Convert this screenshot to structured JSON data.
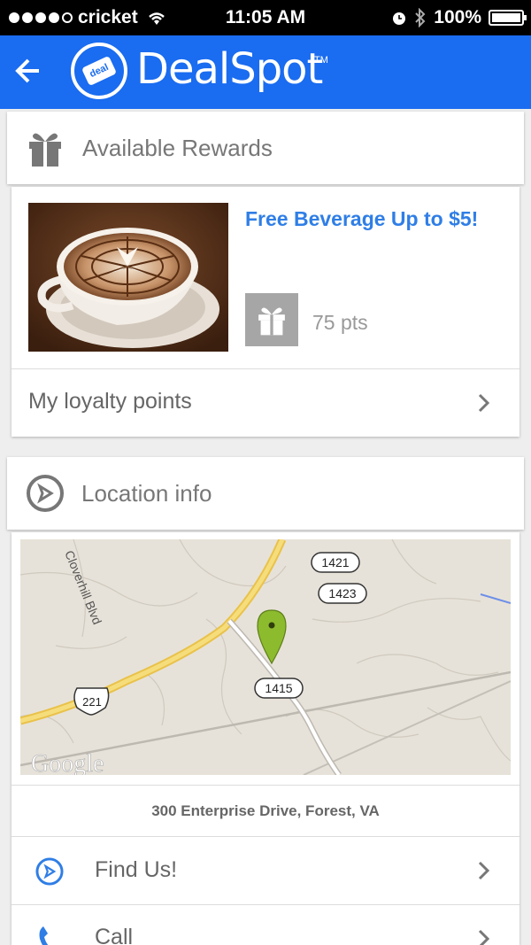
{
  "status_bar": {
    "carrier": "cricket",
    "time": "11:05 AM",
    "battery": "100%",
    "signal_icon": "signal-dots-icon",
    "wifi_icon": "wifi-icon",
    "alarm_icon": "alarm-icon",
    "bluetooth_icon": "bluetooth-icon"
  },
  "app_bar": {
    "brand": "DealSpot",
    "trademark": "TM",
    "logo_tag": "deal",
    "back_icon": "back-arrow-icon",
    "color": "#1a6cf0"
  },
  "rewards": {
    "header": "Available Rewards",
    "header_icon": "gift-icon",
    "item": {
      "title": "Free Beverage Up to $5!",
      "points": "75 pts",
      "image": "latte-art-coffee-cup",
      "accent_color": "#2f7ee6"
    },
    "loyalty_row": "My loyalty points"
  },
  "location": {
    "header": "Location info",
    "header_icon": "compass-icon",
    "map": {
      "street_label": "Cloverhill Blvd",
      "route_badges": [
        "1421",
        "1423",
        "1415",
        "221"
      ],
      "watermark": "Google",
      "pin_icon": "map-pin-icon"
    },
    "address": "300 Enterprise Drive, Forest, VA",
    "actions": [
      {
        "label": "Find Us!",
        "icon": "compass-icon"
      },
      {
        "label": "Call",
        "icon": "phone-icon"
      }
    ]
  }
}
